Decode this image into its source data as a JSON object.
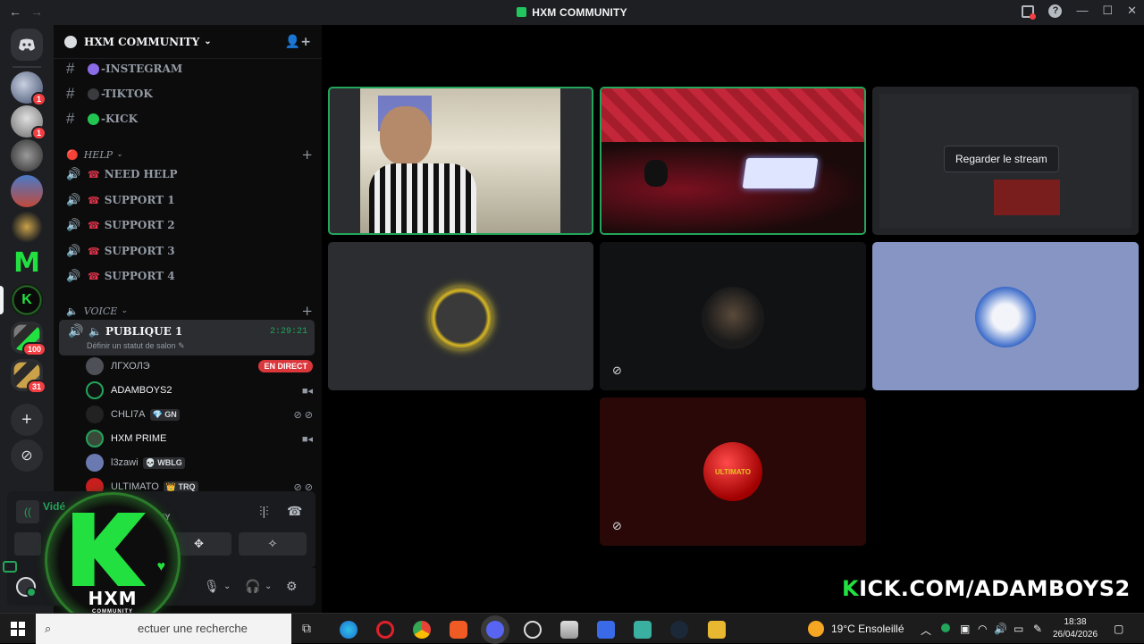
{
  "window": {
    "title": "HXM COMMUNITY",
    "back": "←",
    "forward": "→"
  },
  "server": {
    "name": "HXM COMMUNITY",
    "chevron": "⌄"
  },
  "rail": {
    "servers": [
      {
        "name": "server-discord-home",
        "badge": ""
      },
      {
        "name": "server-1",
        "badge": "1"
      },
      {
        "name": "server-2",
        "badge": "1"
      },
      {
        "name": "server-3",
        "badge": ""
      },
      {
        "name": "server-4",
        "badge": ""
      },
      {
        "name": "server-5",
        "badge": ""
      },
      {
        "name": "server-m",
        "badge": ""
      },
      {
        "name": "server-hxm",
        "badge": ""
      },
      {
        "name": "folder-1",
        "badge": "100"
      },
      {
        "name": "folder-2",
        "badge": "31"
      }
    ]
  },
  "channels": {
    "text": [
      {
        "label": "-INSTEGRAM",
        "color": "#8b6be8"
      },
      {
        "label": "-TIKTOK",
        "color": "#3a3b3f"
      },
      {
        "label": "-KICK",
        "color": "#23c552"
      }
    ],
    "help_category": "HELP",
    "help": [
      "NEED HELP",
      "SUPPORT 1",
      "SUPPORT 2",
      "SUPPORT 3",
      "SUPPORT 4"
    ],
    "voice_category": "VOICE",
    "selected": {
      "name": "PUBLIQUE 1",
      "status": "Définir un statut de salon",
      "time": "2:29:21"
    },
    "members": [
      {
        "name": "ЛГХОЛЭ",
        "tag": "",
        "right": "EN DIRECT"
      },
      {
        "name": "ADAMBOYS2",
        "tag": "",
        "right": "▮◀"
      },
      {
        "name": "CHLI7A",
        "tag": "💎 GN",
        "right": "⊘ ⊘"
      },
      {
        "name": "HXM PRIME",
        "tag": "",
        "right": "▮◀"
      },
      {
        "name": "l3zawi",
        "tag": "💀 WBLG",
        "right": ""
      },
      {
        "name": "ULTIMATO",
        "tag": "👑 TRQ",
        "right": "⊘ ⊘"
      }
    ]
  },
  "voice_panel": {
    "connected": "Vidé",
    "community": "MUNITY"
  },
  "overlay": {
    "brand": "HXM",
    "brand_sub": "COMMUNITY"
  },
  "stage": {
    "watch_stream": "Regarder le stream",
    "kick_url_prefix": "K",
    "kick_url_rest": "ICK.COM/ADAMBOYS2",
    "tile_labels": [
      "",
      "",
      "",
      "",
      "",
      "",
      "ULTIMATO"
    ]
  },
  "taskbar": {
    "search_placeholder": "ectuer une recherche",
    "weather": "19°C  Ensoleillé",
    "time": "18:38",
    "date": "26/04/2026"
  },
  "colors": {
    "green": "#23a55a",
    "kick": "#22e040",
    "live": "#da373c"
  }
}
